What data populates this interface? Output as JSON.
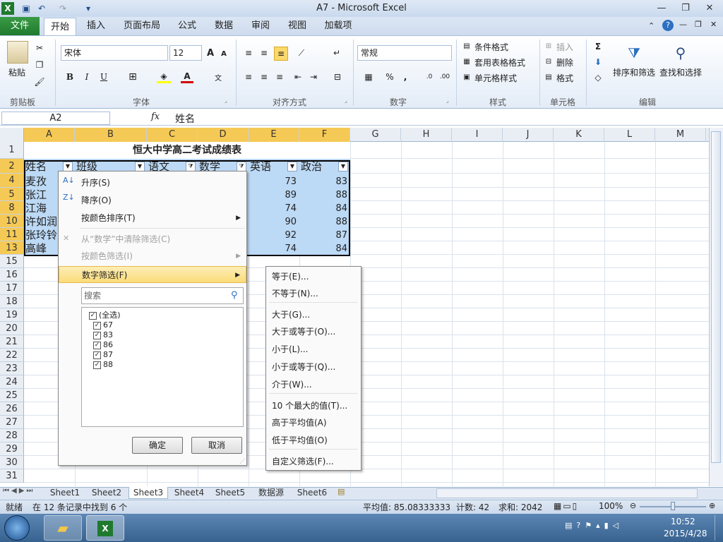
{
  "window": {
    "title": "A7  -  Microsoft Excel"
  },
  "colors": {
    "accent": "#1f7a2e",
    "selection": "#f5c955",
    "cell_selected": "#bcd9f5",
    "menu_highlight": "#fbdc7a"
  },
  "ribbon": {
    "file_tab": "文件",
    "tabs": [
      "开始",
      "插入",
      "页面布局",
      "公式",
      "数据",
      "审阅",
      "视图",
      "加载项"
    ],
    "clipboard": {
      "paste": "粘贴",
      "group": "剪贴板"
    },
    "font": {
      "name": "宋体",
      "size": "12",
      "group": "字体"
    },
    "align": {
      "group": "对齐方式"
    },
    "number": {
      "format": "常规",
      "group": "数字"
    },
    "styles": {
      "cond": "条件格式",
      "table": "套用表格格式",
      "cell": "单元格样式",
      "group": "样式"
    },
    "cells": {
      "insert": "插入",
      "delete": "删除",
      "format": "格式",
      "group": "单元格"
    },
    "edit": {
      "sort": "排序和筛选",
      "find": "查找和选择",
      "group": "编辑"
    }
  },
  "formula": {
    "namebox": "A2",
    "fx": "fx",
    "content": "姓名"
  },
  "columns": [
    "A",
    "B",
    "C",
    "D",
    "E",
    "F",
    "G",
    "H",
    "I",
    "J",
    "K",
    "L",
    "M"
  ],
  "rows": [
    "1",
    "2",
    "4",
    "5",
    "8",
    "10",
    "11",
    "13",
    "15",
    "16",
    "17",
    "18",
    "19",
    "20",
    "21",
    "22",
    "23",
    "24",
    "25",
    "26",
    "27",
    "28",
    "29",
    "30",
    "31"
  ],
  "sheet": {
    "title": "恒大中学高二考试成绩表",
    "headers": [
      "姓名",
      "班级",
      "语文",
      "数学",
      "英语",
      "政治"
    ],
    "data": [
      {
        "name": "麦孜",
        "eng": "73",
        "pol": "83"
      },
      {
        "name": "张江",
        "eng": "89",
        "pol": "88"
      },
      {
        "name": "江海",
        "eng": "74",
        "pol": "84"
      },
      {
        "name": "许如润",
        "eng": "90",
        "pol": "88"
      },
      {
        "name": "张玲铃",
        "eng": "92",
        "pol": "87"
      },
      {
        "name": "高峰",
        "eng": "74",
        "pol": "84"
      }
    ]
  },
  "menu": {
    "sort_asc": "升序(S)",
    "sort_desc": "降序(O)",
    "sort_color": "按颜色排序(T)",
    "clear": "从“数学”中清除筛选(C)",
    "filter_color": "按颜色筛选(I)",
    "number_filter": "数字筛选(F)",
    "search_placeholder": "搜索",
    "items": [
      "(全选)",
      "67",
      "83",
      "86",
      "87",
      "88"
    ],
    "ok": "确定",
    "cancel": "取消"
  },
  "submenu": [
    "等于(E)...",
    "不等于(N)...",
    "大于(G)...",
    "大于或等于(O)...",
    "小于(L)...",
    "小于或等于(Q)...",
    "介于(W)...",
    "10 个最大的值(T)...",
    "高于平均值(A)",
    "低于平均值(O)",
    "自定义筛选(F)..."
  ],
  "sheets": [
    "Sheet1",
    "Sheet2",
    "Sheet3",
    "Sheet4",
    "Sheet5",
    "数据源",
    "Sheet6"
  ],
  "status": {
    "ready": "就绪",
    "found": "在 12 条记录中找到 6 个",
    "avg": "平均值: 85.08333333",
    "count": "计数: 42",
    "sum": "求和: 2042",
    "zoom": "100%"
  },
  "taskbar": {
    "time": "10:52",
    "date": "2015/4/28"
  }
}
